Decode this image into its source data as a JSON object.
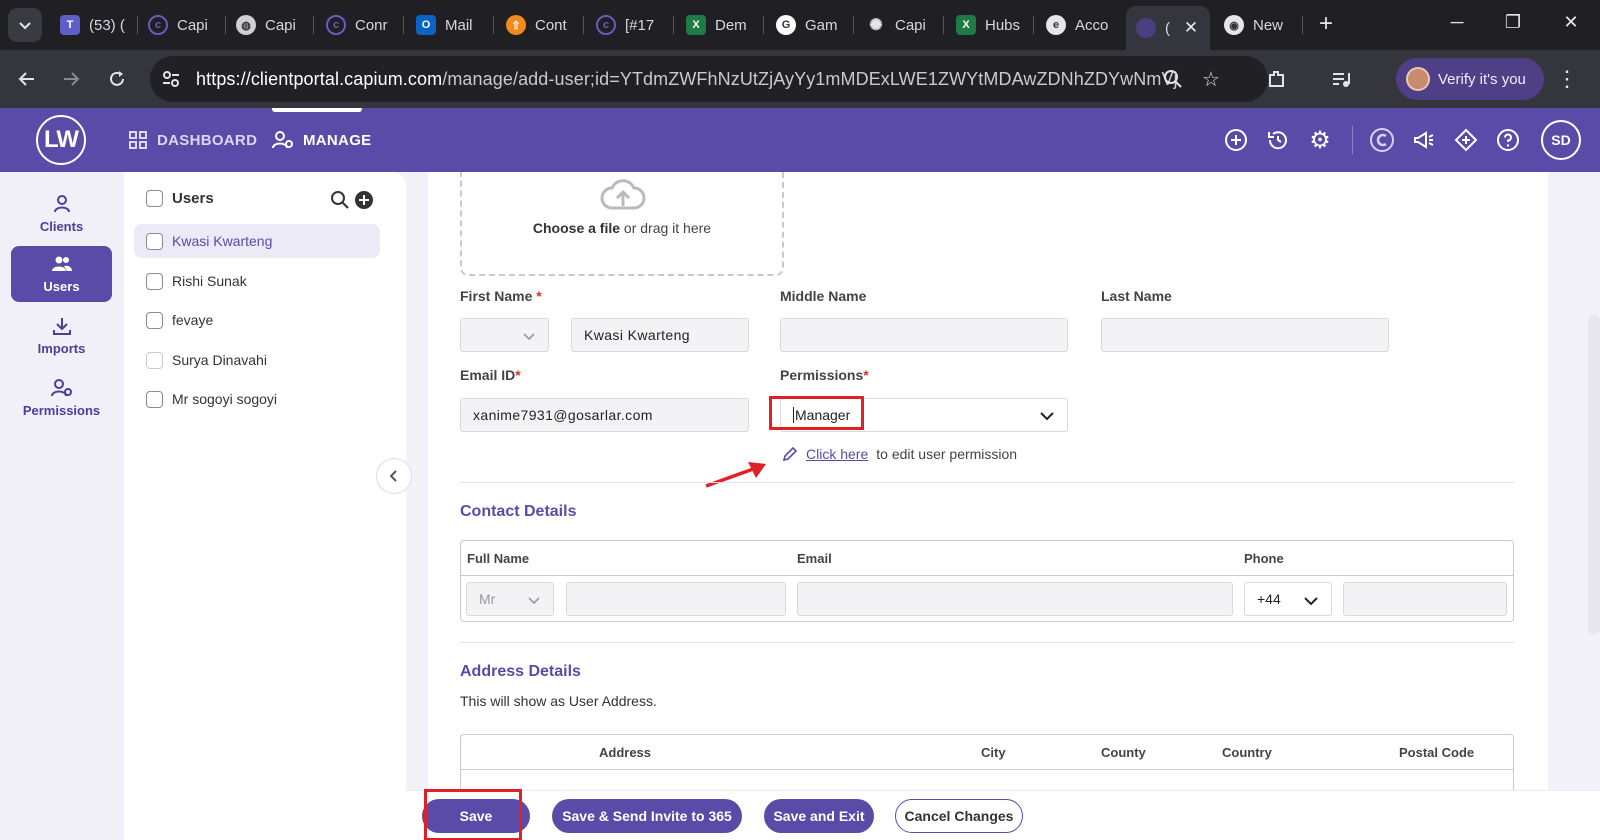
{
  "browser": {
    "tabs": [
      {
        "label": "(53) (",
        "icon": "teams-icon",
        "color": "#5b5fc7"
      },
      {
        "label": "Capi",
        "icon": "capium-icon",
        "color": "#5a4ba8"
      },
      {
        "label": "Capi",
        "icon": "globe-icon",
        "color": "#777"
      },
      {
        "label": "Conr",
        "icon": "capium-icon",
        "color": "#5a4ba8"
      },
      {
        "label": "Mail",
        "icon": "outlook-icon",
        "color": "#0a64c8"
      },
      {
        "label": "Cont",
        "icon": "upload-app-icon",
        "color": "#f08a1c"
      },
      {
        "label": "[#17",
        "icon": "capium-icon",
        "color": "#5a4ba8"
      },
      {
        "label": "Dem",
        "icon": "excel-icon",
        "color": "#1e7b45"
      },
      {
        "label": "Gam",
        "icon": "google-g-icon",
        "color": "#ffffff"
      },
      {
        "label": "Capi",
        "icon": "chatgpt-icon",
        "color": "#ffffff"
      },
      {
        "label": "Hubs",
        "icon": "excel-icon",
        "color": "#1e7b45"
      },
      {
        "label": "Acco",
        "icon": "edge-icon",
        "color": "#ffffff"
      },
      {
        "label": "(",
        "icon": "capium-icon",
        "color": "#5a4ba8"
      },
      {
        "label": "New",
        "icon": "chrome-icon",
        "color": "#ffffff"
      }
    ],
    "url_host": "https://clientportal.capium.com",
    "url_path": "/manage/add-user;id=YTdmZWFhNzUtZjAyYy1mMDExLWE1ZWYtMDAwZDNhZDYwNmVj",
    "profile_label": "Verify it's you"
  },
  "app": {
    "logo": "LW",
    "nav": {
      "dashboard": "DASHBOARD",
      "manage": "MANAGE"
    },
    "avatar": "SD",
    "brand_color": "#5a4ba8"
  },
  "rail": [
    {
      "label": "Clients",
      "icon": "person-icon",
      "active": false
    },
    {
      "label": "Users",
      "icon": "users-icon",
      "active": true
    },
    {
      "label": "Imports",
      "icon": "download-icon",
      "active": false
    },
    {
      "label": "Permissions",
      "icon": "user-gear-icon",
      "active": false
    }
  ],
  "users_panel": {
    "title": "Users",
    "items": [
      "Kwasi Kwarteng",
      "Rishi Sunak",
      "fevaye",
      "Surya Dinavahi",
      "Mr sogoyi sogoyi"
    ]
  },
  "form": {
    "dropzone_bold": "Choose a file",
    "dropzone_rest": " or drag it here",
    "first_name_label": "First Name",
    "first_name_value": "Kwasi  Kwarteng",
    "middle_name_label": "Middle Name",
    "last_name_label": "Last Name",
    "email_label": "Email ID",
    "email_value": "xanime7931@gosarlar.com",
    "permissions_label": "Permissions",
    "permissions_value": "Manager",
    "edit_link": "Click here",
    "edit_link_rest": "to edit user permission",
    "required_mark": "*"
  },
  "contact": {
    "title": "Contact Details",
    "headers": [
      "Full Name",
      "Email",
      "Phone"
    ],
    "title_select": "Mr",
    "phone_code": "+44"
  },
  "address": {
    "title": "Address Details",
    "subtitle": "This will show as User Address.",
    "headers": [
      "Address",
      "City",
      "County",
      "Country",
      "Postal Code"
    ]
  },
  "actions": {
    "save": "Save",
    "save_invite": "Save & Send Invite to 365",
    "save_exit": "Save and Exit",
    "cancel": "Cancel Changes"
  }
}
